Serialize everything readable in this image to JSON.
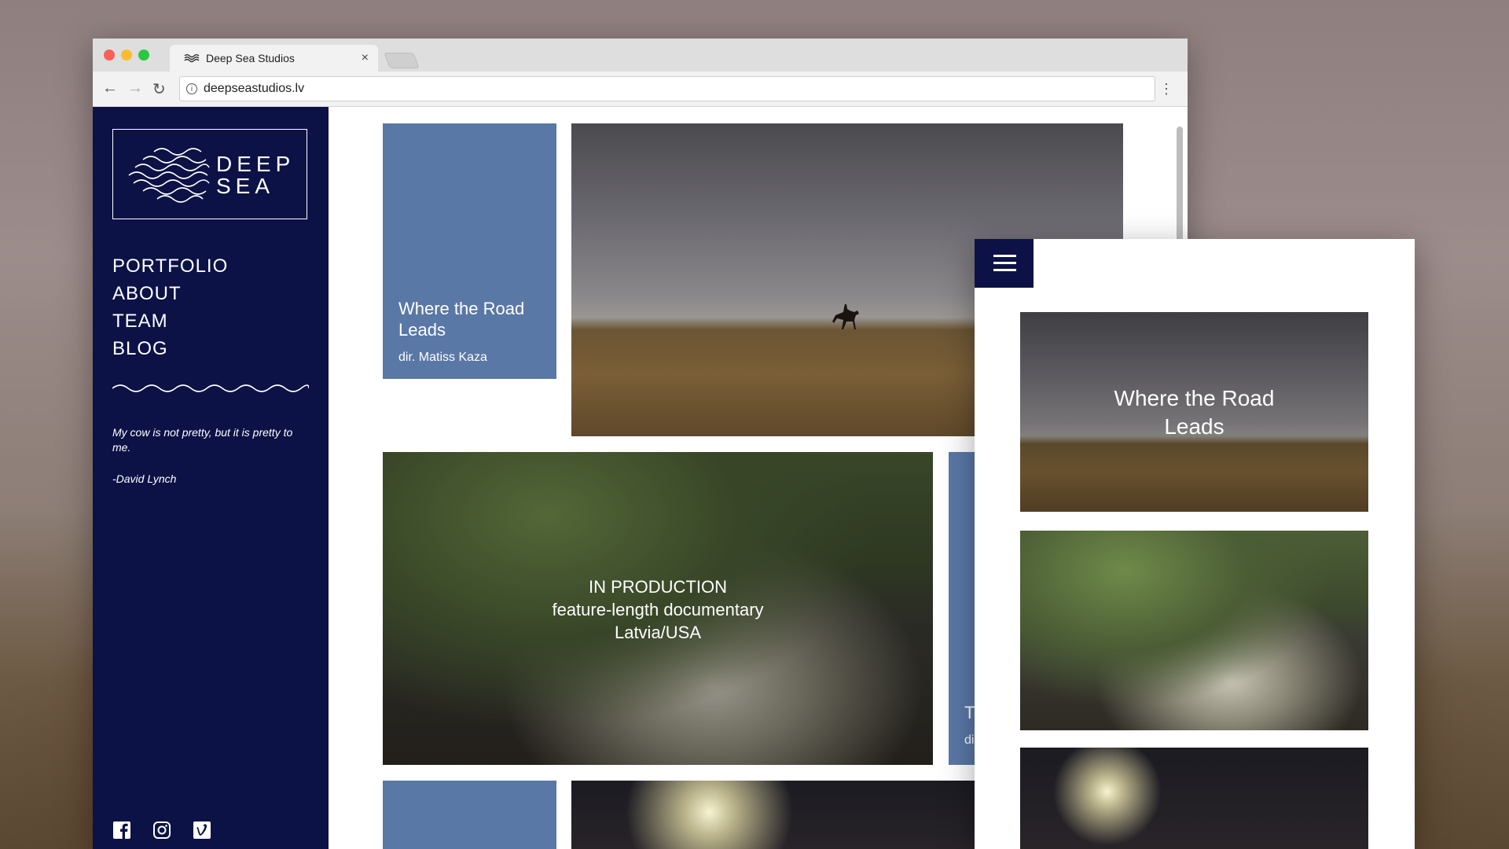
{
  "browser": {
    "tab_title": "Deep Sea Studios",
    "tab_close": "×",
    "url": "deepseastudios.lv",
    "info_glyph": "i",
    "back": "←",
    "forward": "→",
    "reload": "↻",
    "menu": "⋮"
  },
  "sidebar": {
    "logo_text_1": "DEEP",
    "logo_text_2": "SEA",
    "menu": [
      "PORTFOLIO",
      "ABOUT",
      "TEAM",
      "BLOG"
    ],
    "quote": "My cow is not pretty, but it is pretty to me.",
    "author": "-David Lynch",
    "social": [
      "facebook-icon",
      "instagram-icon",
      "vimeo-icon"
    ]
  },
  "tiles": {
    "card1_title": "Where the Road Leads",
    "card1_sub": "dir. Matiss Kaza",
    "production_line1": "IN PRODUCTION",
    "production_line2": "feature-length documentary",
    "production_line3": "Latvia/USA",
    "card2_title_partial": "T",
    "card2_sub_partial": "di"
  },
  "mobile": {
    "tile1_title": "Where the Road Leads"
  },
  "colors": {
    "sidebar": "#0c1246",
    "card": "#5a78a6"
  }
}
